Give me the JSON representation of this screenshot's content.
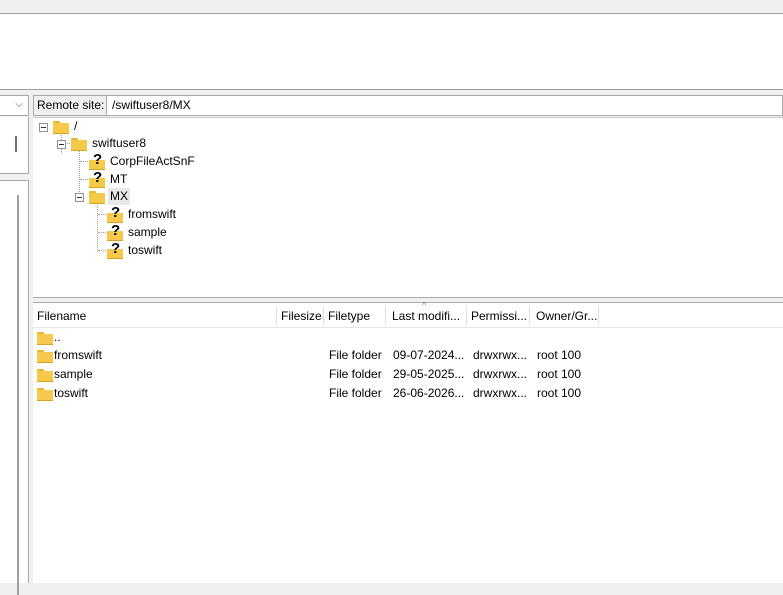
{
  "left_panel": {
    "combo_chevron": "⌵"
  },
  "remote": {
    "label": "Remote site:",
    "path": "/swiftuser8/MX",
    "tree": {
      "root": "/",
      "user": "swiftuser8",
      "children": [
        "CorpFileActSnF",
        "MT",
        "MX"
      ],
      "mx_children": [
        "fromswift",
        "sample",
        "toswift"
      ]
    }
  },
  "file_list": {
    "columns": [
      "Filename",
      "Filesize",
      "Filetype",
      "Last modifi...",
      "Permissi...",
      "Owner/Gr..."
    ],
    "sort_indicator": "^",
    "parent": "..",
    "rows": [
      {
        "name": "fromswift",
        "size": "",
        "type": "File folder",
        "modified": "09-07-2024...",
        "perms": "drwxrwx...",
        "owner": "root 100"
      },
      {
        "name": "sample",
        "size": "",
        "type": "File folder",
        "modified": "29-05-2025...",
        "perms": "drwxrwx...",
        "owner": "root 100"
      },
      {
        "name": "toswift",
        "size": "",
        "type": "File folder",
        "modified": "26-06-2026...",
        "perms": "drwxrwx...",
        "owner": "root 100"
      }
    ]
  }
}
